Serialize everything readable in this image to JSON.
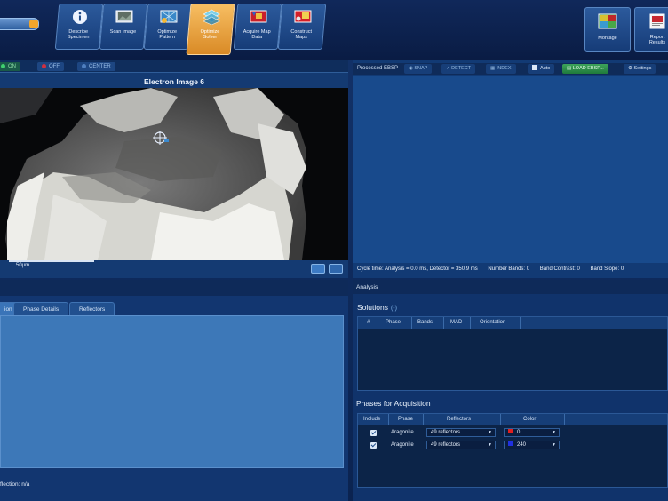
{
  "toolbar": {
    "buttons": [
      {
        "label": "Describe\nSpecimen",
        "icon": "info-icon"
      },
      {
        "label": "Scan Image",
        "icon": "scan-image-icon"
      },
      {
        "label": "Optimize\nPattern",
        "icon": "optimize-pattern-icon"
      },
      {
        "label": "Optimize\nSolver",
        "icon": "optimize-solver-icon"
      },
      {
        "label": "Acquire Map\nData",
        "icon": "acquire-map-icon"
      },
      {
        "label": "Construct\nMaps",
        "icon": "construct-maps-icon"
      }
    ],
    "right_buttons": [
      {
        "label": "Montage",
        "icon": "montage-icon"
      },
      {
        "label": "Report\nResults",
        "icon": "report-icon"
      }
    ],
    "active_color": "#e9a440"
  },
  "image_panel": {
    "toggles": {
      "on": "ON",
      "off": "OFF",
      "center": "CENTER"
    },
    "title": "Electron Image 6",
    "scale_label": "50µm"
  },
  "ebsp_panel": {
    "title": "Processed EBSP",
    "buttons": {
      "snap": "SNAP",
      "detect": "DETECT",
      "index": "INDEX",
      "auto": "Auto",
      "load": "LOAD EBSP...",
      "settings": "Settings"
    },
    "status": {
      "cycle": "Cycle time: Analysis = 0.0 ms, Detector = 350.9 ms",
      "bands": "Number Bands: 0",
      "contrast": "Band Contrast: 0",
      "slope": "Band Slope: 0"
    }
  },
  "bottom_left": {
    "tabs": [
      "ion",
      "Phase Details",
      "Reflectors"
    ],
    "status": "flection: n/a"
  },
  "analysis": {
    "header": "Analysis",
    "solutions_title": "Solutions",
    "solutions_count": "(-)",
    "solutions_columns": [
      "#",
      "Phase",
      "Bands",
      "MAD",
      "Orientation"
    ],
    "phases_title": "Phases for Acquisition",
    "phases_columns": [
      "Include",
      "Phase",
      "Reflectors",
      "Color"
    ],
    "phases_rows": [
      {
        "phase": "Aragonite",
        "reflectors": "49 reflectors",
        "color_value": "0",
        "swatch": "#e02020"
      },
      {
        "phase": "Aragonite",
        "reflectors": "49 reflectors",
        "color_value": "240",
        "swatch": "#2030e0"
      }
    ]
  }
}
